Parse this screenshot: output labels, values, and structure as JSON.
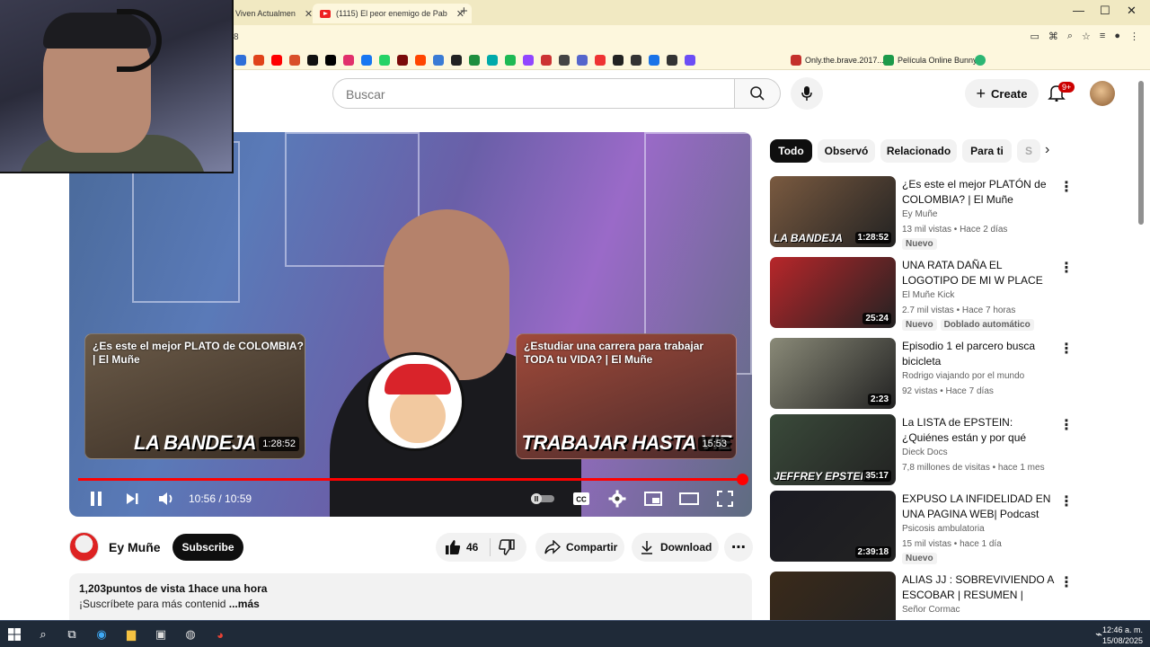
{
  "browser": {
    "tabs": [
      {
        "label": "Viven Actualmen",
        "active": false
      },
      {
        "label": "(1115) El peor enemigo de Pab",
        "active": true
      }
    ],
    "address_fragment": "8",
    "bookmarks": [
      {
        "label": "Only.the.brave.2017...."
      },
      {
        "label": "Película Online Bunny"
      }
    ]
  },
  "youtube": {
    "search": {
      "placeholder": "Buscar"
    },
    "create_label": "Create",
    "notifications_badge": "9+"
  },
  "player": {
    "endcards": [
      {
        "title": "¿Es este el mejor PLATO de COLOMBIA? | El Muñe",
        "thumb_text": "LA BANDEJA",
        "duration": "1:28:52"
      },
      {
        "title": "¿Estudiar una carrera para trabajar TODA tu VIDA? | El Muñe",
        "thumb_text": "TRABAJAR HASTA VIE",
        "duration": "15:53"
      }
    ],
    "time_display": "10:56 / 10:59",
    "progress_fraction": 0.998
  },
  "video": {
    "channel_name": "Ey Muñe",
    "subscribe_label": "Subscribe",
    "like_count": "46",
    "share_label": "Compartir",
    "download_label": "Download",
    "description": {
      "stats": "1,203puntos de vista  1hace una hora",
      "text": "¡Suscríbete para más contenid",
      "more": "...más"
    }
  },
  "chips": [
    "Todo",
    "Observó",
    "Relacionado",
    "Para ti",
    "S"
  ],
  "recommendations": [
    {
      "title": "¿Es este el mejor PLATÓN de COLOMBIA? | El Muñe",
      "channel": "Ey Muñe",
      "meta": "13 mil vistas • Hace 2 días",
      "tags": [
        "Nuevo"
      ],
      "duration": "1:28:52",
      "thumb_text": "LA BANDEJA",
      "color": "#7a5a40"
    },
    {
      "title": "UNA RATA DAÑA EL LOGOTIPO DE MI W PLACE EN LA ...",
      "channel": "El Muñe Kick",
      "meta": "2.7 mil vistas • Hace 7 horas",
      "tags": [
        "Nuevo",
        "Doblado automático"
      ],
      "duration": "25:24",
      "thumb_text": "",
      "color": "#b8262a"
    },
    {
      "title": "Episodio 1 el parcero busca bicicleta",
      "channel": "Rodrigo viajando por el mundo",
      "meta": "92 vistas • Hace 7 días",
      "tags": [],
      "duration": "2:23",
      "thumb_text": "",
      "color": "#8a8a78"
    },
    {
      "title": "La LISTA de EPSTEIN: ¿Quiénes están y por qué NADIE habla d...",
      "channel": "Dieck Docs",
      "meta": "7,8 millones de visitas • hace 1 mes",
      "tags": [],
      "duration": "35:17",
      "thumb_text": "JEFFREY EPSTEIN",
      "color": "#3a4a3a"
    },
    {
      "title": "EXPUSO LA INFIDELIDAD EN UNA PAGINA WEB| Podcast de...",
      "channel": "Psicosis ambulatoria",
      "meta": "15 mil vistas • hace 1 día",
      "tags": [
        "Nuevo"
      ],
      "duration": "2:39:18",
      "thumb_text": "",
      "color": "#1a1a22"
    },
    {
      "title": "ALIAS JJ : SOBREVIVIENDO A ESCOBAR | RESUMEN | SEÑO...",
      "channel": "Señor Cormac",
      "meta": "",
      "tags": [],
      "duration": "",
      "thumb_text": "ESCOBAR",
      "color": "#3a2a1a"
    }
  ],
  "taskbar": {
    "time": "12:46 a. m.",
    "date": "15/08/2025"
  },
  "colors": {
    "accent_red": "#ff0000",
    "chrome_tab_bg": "#f1e9c2",
    "taskbar_bg": "#1f2a38"
  }
}
